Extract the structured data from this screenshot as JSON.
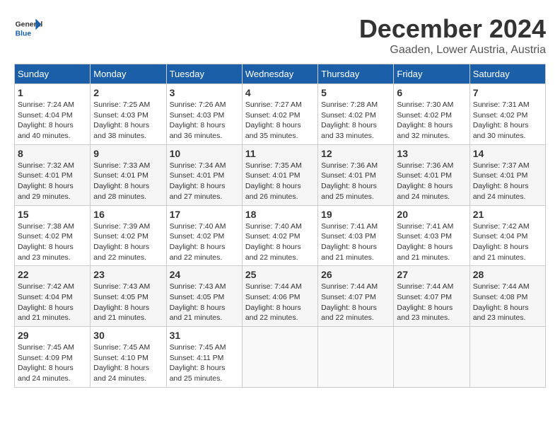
{
  "header": {
    "logo_general": "General",
    "logo_blue": "Blue",
    "month_title": "December 2024",
    "location": "Gaaden, Lower Austria, Austria"
  },
  "days_of_week": [
    "Sunday",
    "Monday",
    "Tuesday",
    "Wednesday",
    "Thursday",
    "Friday",
    "Saturday"
  ],
  "weeks": [
    [
      {
        "day": "1",
        "sunrise": "7:24 AM",
        "sunset": "4:04 PM",
        "daylight": "8 hours and 40 minutes."
      },
      {
        "day": "2",
        "sunrise": "7:25 AM",
        "sunset": "4:03 PM",
        "daylight": "8 hours and 38 minutes."
      },
      {
        "day": "3",
        "sunrise": "7:26 AM",
        "sunset": "4:03 PM",
        "daylight": "8 hours and 36 minutes."
      },
      {
        "day": "4",
        "sunrise": "7:27 AM",
        "sunset": "4:02 PM",
        "daylight": "8 hours and 35 minutes."
      },
      {
        "day": "5",
        "sunrise": "7:28 AM",
        "sunset": "4:02 PM",
        "daylight": "8 hours and 33 minutes."
      },
      {
        "day": "6",
        "sunrise": "7:30 AM",
        "sunset": "4:02 PM",
        "daylight": "8 hours and 32 minutes."
      },
      {
        "day": "7",
        "sunrise": "7:31 AM",
        "sunset": "4:02 PM",
        "daylight": "8 hours and 30 minutes."
      }
    ],
    [
      {
        "day": "8",
        "sunrise": "7:32 AM",
        "sunset": "4:01 PM",
        "daylight": "8 hours and 29 minutes."
      },
      {
        "day": "9",
        "sunrise": "7:33 AM",
        "sunset": "4:01 PM",
        "daylight": "8 hours and 28 minutes."
      },
      {
        "day": "10",
        "sunrise": "7:34 AM",
        "sunset": "4:01 PM",
        "daylight": "8 hours and 27 minutes."
      },
      {
        "day": "11",
        "sunrise": "7:35 AM",
        "sunset": "4:01 PM",
        "daylight": "8 hours and 26 minutes."
      },
      {
        "day": "12",
        "sunrise": "7:36 AM",
        "sunset": "4:01 PM",
        "daylight": "8 hours and 25 minutes."
      },
      {
        "day": "13",
        "sunrise": "7:36 AM",
        "sunset": "4:01 PM",
        "daylight": "8 hours and 24 minutes."
      },
      {
        "day": "14",
        "sunrise": "7:37 AM",
        "sunset": "4:01 PM",
        "daylight": "8 hours and 24 minutes."
      }
    ],
    [
      {
        "day": "15",
        "sunrise": "7:38 AM",
        "sunset": "4:02 PM",
        "daylight": "8 hours and 23 minutes."
      },
      {
        "day": "16",
        "sunrise": "7:39 AM",
        "sunset": "4:02 PM",
        "daylight": "8 hours and 22 minutes."
      },
      {
        "day": "17",
        "sunrise": "7:40 AM",
        "sunset": "4:02 PM",
        "daylight": "8 hours and 22 minutes."
      },
      {
        "day": "18",
        "sunrise": "7:40 AM",
        "sunset": "4:02 PM",
        "daylight": "8 hours and 22 minutes."
      },
      {
        "day": "19",
        "sunrise": "7:41 AM",
        "sunset": "4:03 PM",
        "daylight": "8 hours and 21 minutes."
      },
      {
        "day": "20",
        "sunrise": "7:41 AM",
        "sunset": "4:03 PM",
        "daylight": "8 hours and 21 minutes."
      },
      {
        "day": "21",
        "sunrise": "7:42 AM",
        "sunset": "4:04 PM",
        "daylight": "8 hours and 21 minutes."
      }
    ],
    [
      {
        "day": "22",
        "sunrise": "7:42 AM",
        "sunset": "4:04 PM",
        "daylight": "8 hours and 21 minutes."
      },
      {
        "day": "23",
        "sunrise": "7:43 AM",
        "sunset": "4:05 PM",
        "daylight": "8 hours and 21 minutes."
      },
      {
        "day": "24",
        "sunrise": "7:43 AM",
        "sunset": "4:05 PM",
        "daylight": "8 hours and 21 minutes."
      },
      {
        "day": "25",
        "sunrise": "7:44 AM",
        "sunset": "4:06 PM",
        "daylight": "8 hours and 22 minutes."
      },
      {
        "day": "26",
        "sunrise": "7:44 AM",
        "sunset": "4:07 PM",
        "daylight": "8 hours and 22 minutes."
      },
      {
        "day": "27",
        "sunrise": "7:44 AM",
        "sunset": "4:07 PM",
        "daylight": "8 hours and 23 minutes."
      },
      {
        "day": "28",
        "sunrise": "7:44 AM",
        "sunset": "4:08 PM",
        "daylight": "8 hours and 23 minutes."
      }
    ],
    [
      {
        "day": "29",
        "sunrise": "7:45 AM",
        "sunset": "4:09 PM",
        "daylight": "8 hours and 24 minutes."
      },
      {
        "day": "30",
        "sunrise": "7:45 AM",
        "sunset": "4:10 PM",
        "daylight": "8 hours and 24 minutes."
      },
      {
        "day": "31",
        "sunrise": "7:45 AM",
        "sunset": "4:11 PM",
        "daylight": "8 hours and 25 minutes."
      },
      null,
      null,
      null,
      null
    ]
  ],
  "labels": {
    "sunrise": "Sunrise:",
    "sunset": "Sunset:",
    "daylight": "Daylight:"
  }
}
